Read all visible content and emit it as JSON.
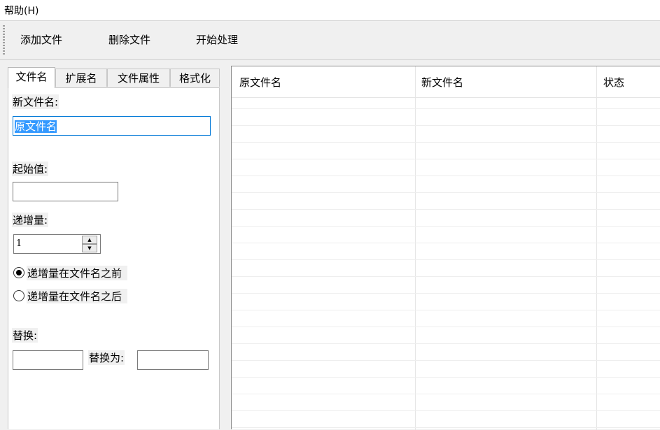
{
  "menu": {
    "help": "帮助(H)"
  },
  "toolbar": {
    "add": "添加文件",
    "remove": "删除文件",
    "start": "开始处理"
  },
  "tabs": [
    "文件名",
    "扩展名",
    "文件属性",
    "格式化"
  ],
  "panel": {
    "new_name_label": "新文件名:",
    "new_name_value": "原文件名",
    "start_label": "起始值:",
    "start_value": "",
    "increment_label": "递增量:",
    "increment_value": "1",
    "radio_before": "递增量在文件名之前",
    "radio_after": "递增量在文件名之后",
    "radio_selected": "before",
    "replace_label": "替换:",
    "replace_value": "",
    "replace_with_label": "替换为:",
    "replace_with_value": ""
  },
  "grid": {
    "columns": [
      "原文件名",
      "新文件名",
      "状态"
    ],
    "rows": []
  }
}
